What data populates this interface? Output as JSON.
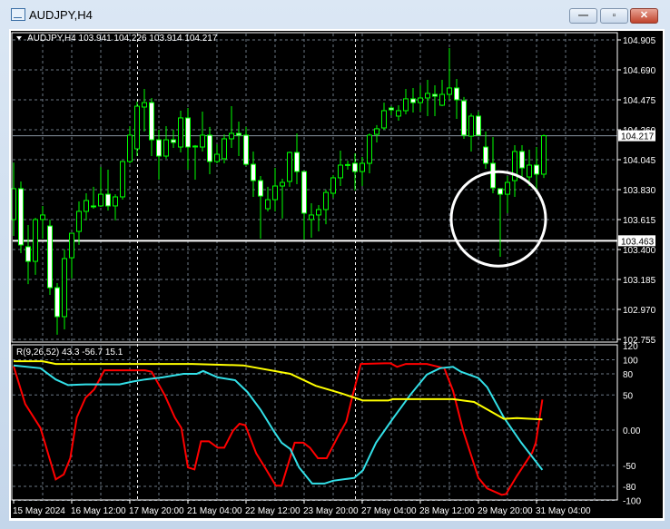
{
  "window": {
    "title": "AUDJPY,H4",
    "buttons": {
      "minimize": "—",
      "maximize": "▫",
      "close": "✕"
    }
  },
  "main_pane": {
    "header": "AUDJPY,H4  103.941 104.226 103.914 104.217",
    "price_ticks": [
      "104.905",
      "104.690",
      "104.475",
      "104.260",
      "104.045",
      "103.830",
      "103.615",
      "103.400",
      "103.185",
      "102.970",
      "102.755"
    ],
    "bid_label": "104.217",
    "hline_label": "103.463"
  },
  "indicator_pane": {
    "header": "R(9,26,52) 43.3 -56.7 15.1",
    "ticks": [
      "120",
      "100",
      "80",
      "50",
      "0.00",
      "-50",
      "-80",
      "-100"
    ]
  },
  "time_axis": {
    "labels": [
      "15 May 2024",
      "16 May 12:00",
      "17 May 20:00",
      "21 May 04:00",
      "22 May 12:00",
      "23 May 20:00",
      "27 May 04:00",
      "28 May 12:00",
      "29 May 20:00",
      "31 May 04:00"
    ]
  },
  "colors": {
    "bull": "#00ff00",
    "bear_body": "#ffffff",
    "grid": "#6b7785",
    "red": "#ff0000",
    "cyan": "#33e0e8",
    "yellow": "#ffff00"
  },
  "chart_data": [
    {
      "type": "candlestick",
      "title": "AUDJPY,H4",
      "ylim": [
        102.755,
        104.905
      ],
      "bid": 104.217,
      "horizontal_line": 103.463,
      "separators_bar_index": [
        17,
        47
      ],
      "annotation_circle": {
        "bar_index": 67,
        "price": 103.62
      },
      "ohlc": [
        [
          103.615,
          104.025,
          103.498,
          103.837
        ],
        [
          103.837,
          103.889,
          103.374,
          103.433
        ],
        [
          103.42,
          103.576,
          103.152,
          103.315
        ],
        [
          103.315,
          103.628,
          103.218,
          103.615
        ],
        [
          103.615,
          103.713,
          103.478,
          103.648
        ],
        [
          103.569,
          103.615,
          103.074,
          103.126
        ],
        [
          103.126,
          103.159,
          102.788,
          102.918
        ],
        [
          102.918,
          103.4,
          102.827,
          103.335
        ],
        [
          103.341,
          103.517,
          103.192,
          103.517
        ],
        [
          103.53,
          103.745,
          103.433,
          103.674
        ],
        [
          103.674,
          103.804,
          103.609,
          103.752
        ],
        [
          103.713,
          103.85,
          103.693,
          103.706
        ],
        [
          103.713,
          103.993,
          103.706,
          103.797
        ],
        [
          103.797,
          103.973,
          103.68,
          103.713
        ],
        [
          103.713,
          103.797,
          103.609,
          103.778
        ],
        [
          103.778,
          104.038,
          103.758,
          104.032
        ],
        [
          104.032,
          104.286,
          104.019,
          104.221
        ],
        [
          104.123,
          104.462,
          104.071,
          104.429
        ],
        [
          104.423,
          104.553,
          104.247,
          104.455
        ],
        [
          104.455,
          104.488,
          104.071,
          104.188
        ],
        [
          104.188,
          104.26,
          103.902,
          104.071
        ],
        [
          104.071,
          104.286,
          104.052,
          104.188
        ],
        [
          104.188,
          104.26,
          104.13,
          104.169
        ],
        [
          104.136,
          104.397,
          104.097,
          104.345
        ],
        [
          104.345,
          104.416,
          103.973,
          104.136
        ],
        [
          104.143,
          104.15,
          103.902,
          104.14
        ],
        [
          104.136,
          104.39,
          104.104,
          104.221
        ],
        [
          104.221,
          104.28,
          103.941,
          104.032
        ],
        [
          104.032,
          104.156,
          104.019,
          104.084
        ],
        [
          104.052,
          104.227,
          104.019,
          104.195
        ],
        [
          104.195,
          104.429,
          104.13,
          104.234
        ],
        [
          104.234,
          104.319,
          104.071,
          104.221
        ],
        [
          104.221,
          104.28,
          103.999,
          104.012
        ],
        [
          104.012,
          104.104,
          103.778,
          103.895
        ],
        [
          103.895,
          103.928,
          103.478,
          103.784
        ],
        [
          103.693,
          103.85,
          103.674,
          103.758
        ],
        [
          103.758,
          103.986,
          103.674,
          103.856
        ],
        [
          103.856,
          103.908,
          103.622,
          103.882
        ],
        [
          103.889,
          104.104,
          103.85,
          104.097
        ],
        [
          104.097,
          104.234,
          103.869,
          103.96
        ],
        [
          103.96,
          103.96,
          103.472,
          103.661
        ],
        [
          103.615,
          103.732,
          103.485,
          103.648
        ],
        [
          103.648,
          103.719,
          103.53,
          103.687
        ],
        [
          103.687,
          103.83,
          103.582,
          103.81
        ],
        [
          103.804,
          103.934,
          103.771,
          103.915
        ],
        [
          103.915,
          104.11,
          103.856,
          104.006
        ],
        [
          104.006,
          104.038,
          103.973,
          104.01
        ],
        [
          104.019,
          104.091,
          103.824,
          103.96
        ],
        [
          103.96,
          104.065,
          103.856,
          104.019
        ],
        [
          104.019,
          104.234,
          103.947,
          104.221
        ],
        [
          104.227,
          104.293,
          104.169,
          104.267
        ],
        [
          104.273,
          104.455,
          104.26,
          104.397
        ],
        [
          104.416,
          104.429,
          104.364,
          104.403
        ],
        [
          104.358,
          104.436,
          104.325,
          104.397
        ],
        [
          104.397,
          104.553,
          104.371,
          104.482
        ],
        [
          104.482,
          104.56,
          104.384,
          104.455
        ],
        [
          104.455,
          104.579,
          104.39,
          104.488
        ],
        [
          104.488,
          104.618,
          104.358,
          104.521
        ],
        [
          104.514,
          104.579,
          104.358,
          104.501
        ],
        [
          104.436,
          104.618,
          104.429,
          104.514
        ],
        [
          104.514,
          104.846,
          104.475,
          104.56
        ],
        [
          104.56,
          104.625,
          104.338,
          104.475
        ],
        [
          104.468,
          104.495,
          104.195,
          104.221
        ],
        [
          104.214,
          104.377,
          104.104,
          104.358
        ],
        [
          104.358,
          104.39,
          104.214,
          104.221
        ],
        [
          104.136,
          104.247,
          103.98,
          104.019
        ],
        [
          104.019,
          104.208,
          103.804,
          103.843
        ],
        [
          103.837,
          103.837,
          103.348,
          103.797
        ],
        [
          103.797,
          103.928,
          103.661,
          103.882
        ],
        [
          103.895,
          104.149,
          103.778,
          104.104
        ],
        [
          104.104,
          104.149,
          103.908,
          103.986
        ],
        [
          103.921,
          104.117,
          103.856,
          104.006
        ],
        [
          104.006,
          104.136,
          103.824,
          103.941
        ],
        [
          103.941,
          104.226,
          103.914,
          104.217
        ]
      ]
    },
    {
      "type": "line",
      "title": "R(9,26,52)",
      "ylim": [
        -110,
        125
      ],
      "series": [
        {
          "name": "R9",
          "color": "#ff0000",
          "points": [
            [
              0,
              91
            ],
            [
              1.6,
              37
            ],
            [
              3.7,
              3
            ],
            [
              5.8,
              -70
            ],
            [
              6.9,
              -63
            ],
            [
              7.8,
              -40
            ],
            [
              8.7,
              18
            ],
            [
              9.9,
              46
            ],
            [
              11.1,
              58
            ],
            [
              12.5,
              85
            ],
            [
              15.8,
              85
            ],
            [
              18.1,
              85
            ],
            [
              19,
              83
            ],
            [
              20.8,
              50
            ],
            [
              22.2,
              18
            ],
            [
              23.1,
              3
            ],
            [
              24,
              -53
            ],
            [
              24.9,
              -56
            ],
            [
              25.8,
              -16
            ],
            [
              26.9,
              -16
            ],
            [
              28.1,
              -25
            ],
            [
              29,
              -25
            ],
            [
              30.2,
              -1
            ],
            [
              31.1,
              9
            ],
            [
              31.9,
              7
            ],
            [
              33.4,
              -33
            ],
            [
              34.6,
              -53
            ],
            [
              36.1,
              -79
            ],
            [
              36.9,
              -79
            ],
            [
              38.7,
              -18
            ],
            [
              39.9,
              -18
            ],
            [
              40.8,
              -25
            ],
            [
              41.9,
              -40
            ],
            [
              43.1,
              -40
            ],
            [
              44.6,
              -10
            ],
            [
              45.8,
              12
            ],
            [
              46.6,
              46
            ],
            [
              47.8,
              94
            ],
            [
              51.1,
              95
            ],
            [
              51.9,
              95
            ],
            [
              52.8,
              90
            ],
            [
              54,
              94
            ],
            [
              56.9,
              94
            ],
            [
              59.3,
              88
            ],
            [
              60.5,
              56
            ],
            [
              61.9,
              -1
            ],
            [
              64,
              -68
            ],
            [
              65.2,
              -83
            ],
            [
              67.2,
              -92
            ],
            [
              67.8,
              -91
            ],
            [
              69.3,
              -65
            ],
            [
              71.4,
              -32
            ],
            [
              71.9,
              -18
            ],
            [
              72.8,
              43.3
            ]
          ]
        },
        {
          "name": "R26",
          "color": "#33e0e8",
          "points": [
            [
              0,
              92
            ],
            [
              3.7,
              88
            ],
            [
              5.8,
              72
            ],
            [
              7.5,
              64
            ],
            [
              9.9,
              65
            ],
            [
              14.6,
              65
            ],
            [
              16.4,
              69
            ],
            [
              18.1,
              72
            ],
            [
              20.5,
              75
            ],
            [
              23.4,
              80
            ],
            [
              25.2,
              80
            ],
            [
              26.1,
              84
            ],
            [
              28.1,
              75
            ],
            [
              30.5,
              71
            ],
            [
              32.2,
              54
            ],
            [
              34,
              29
            ],
            [
              35.8,
              -1
            ],
            [
              36.9,
              -18
            ],
            [
              38.1,
              -27
            ],
            [
              39.3,
              -53
            ],
            [
              41.1,
              -76
            ],
            [
              42.8,
              -76
            ],
            [
              44,
              -72
            ],
            [
              46.9,
              -68
            ],
            [
              48.1,
              -57
            ],
            [
              49.9,
              -18
            ],
            [
              52.2,
              16
            ],
            [
              54.6,
              50
            ],
            [
              56.9,
              79
            ],
            [
              58.7,
              88
            ],
            [
              60.5,
              90
            ],
            [
              61.6,
              83
            ],
            [
              64,
              74
            ],
            [
              65.2,
              61
            ],
            [
              67.5,
              18
            ],
            [
              69.9,
              -18
            ],
            [
              72.8,
              -56.7
            ]
          ]
        },
        {
          "name": "R52",
          "color": "#ffff00",
          "points": [
            [
              0,
              98
            ],
            [
              4,
              98
            ],
            [
              5.8,
              94
            ],
            [
              24.6,
              94
            ],
            [
              31.6,
              92
            ],
            [
              38.1,
              80
            ],
            [
              41.6,
              63
            ],
            [
              45.2,
              52
            ],
            [
              48.1,
              42
            ],
            [
              51.6,
              42
            ],
            [
              52.2,
              44
            ],
            [
              60.5,
              44
            ],
            [
              63.4,
              40
            ],
            [
              67.5,
              16
            ],
            [
              69.3,
              17
            ],
            [
              72.8,
              15.1
            ]
          ]
        }
      ],
      "tick_values": [
        120,
        100,
        80,
        50,
        0,
        -50,
        -80,
        -100
      ]
    }
  ]
}
